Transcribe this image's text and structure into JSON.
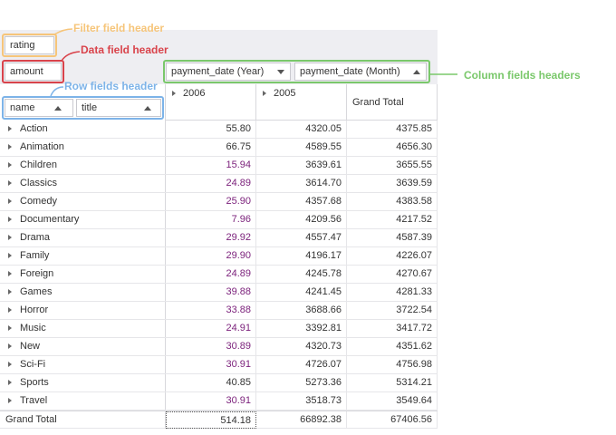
{
  "callouts": {
    "filter": "Filter field header",
    "data": "Data field header",
    "row": "Row fields header",
    "column": "Column fields headers"
  },
  "colors": {
    "filter": "#f6c57a",
    "data": "#d9434b",
    "row": "#7db3e8",
    "column": "#7ac86b",
    "purple_value": "#7a1f7a"
  },
  "fields": {
    "filter": "rating",
    "data": "amount",
    "columns": [
      "payment_date (Year)",
      "payment_date (Month)"
    ],
    "rows": [
      "name",
      "title"
    ]
  },
  "columns": {
    "c1": "2006",
    "c2": "2005",
    "total": "Grand Total"
  },
  "rows": [
    {
      "label": "Action",
      "v2006": "55.80",
      "v2005": "4320.05",
      "total": "4375.85",
      "hl": false
    },
    {
      "label": "Animation",
      "v2006": "66.75",
      "v2005": "4589.55",
      "total": "4656.30",
      "hl": false
    },
    {
      "label": "Children",
      "v2006": "15.94",
      "v2005": "3639.61",
      "total": "3655.55",
      "hl": true
    },
    {
      "label": "Classics",
      "v2006": "24.89",
      "v2005": "3614.70",
      "total": "3639.59",
      "hl": true
    },
    {
      "label": "Comedy",
      "v2006": "25.90",
      "v2005": "4357.68",
      "total": "4383.58",
      "hl": true
    },
    {
      "label": "Documentary",
      "v2006": "7.96",
      "v2005": "4209.56",
      "total": "4217.52",
      "hl": true
    },
    {
      "label": "Drama",
      "v2006": "29.92",
      "v2005": "4557.47",
      "total": "4587.39",
      "hl": true
    },
    {
      "label": "Family",
      "v2006": "29.90",
      "v2005": "4196.17",
      "total": "4226.07",
      "hl": true
    },
    {
      "label": "Foreign",
      "v2006": "24.89",
      "v2005": "4245.78",
      "total": "4270.67",
      "hl": true
    },
    {
      "label": "Games",
      "v2006": "39.88",
      "v2005": "4241.45",
      "total": "4281.33",
      "hl": true
    },
    {
      "label": "Horror",
      "v2006": "33.88",
      "v2005": "3688.66",
      "total": "3722.54",
      "hl": true
    },
    {
      "label": "Music",
      "v2006": "24.91",
      "v2005": "3392.81",
      "total": "3417.72",
      "hl": true
    },
    {
      "label": "New",
      "v2006": "30.89",
      "v2005": "4320.73",
      "total": "4351.62",
      "hl": true
    },
    {
      "label": "Sci-Fi",
      "v2006": "30.91",
      "v2005": "4726.07",
      "total": "4756.98",
      "hl": true
    },
    {
      "label": "Sports",
      "v2006": "40.85",
      "v2005": "5273.36",
      "total": "5314.21",
      "hl": false
    },
    {
      "label": "Travel",
      "v2006": "30.91",
      "v2005": "3518.73",
      "total": "3549.64",
      "hl": true
    }
  ],
  "grand_total": {
    "label": "Grand Total",
    "v2006": "514.18",
    "v2005": "66892.38",
    "total": "67406.56"
  }
}
